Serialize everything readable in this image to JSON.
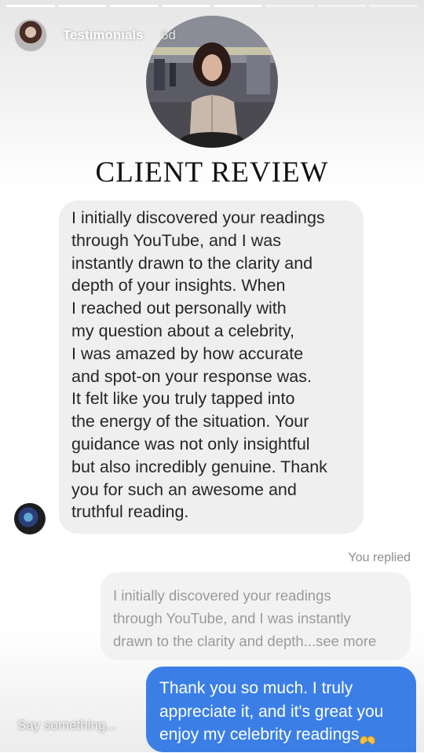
{
  "story": {
    "username": "Testimonials",
    "time_ago": "6d",
    "segments_total": 8,
    "segments_viewed": 5
  },
  "title": "CLIENT REVIEW",
  "messages": {
    "incoming_lines": [
      "I initially discovered your readings",
      "through YouTube, and I was",
      "instantly drawn to the clarity and",
      "depth of your insights. When",
      "I reached out personally with",
      "my question about a celebrity,",
      "I was amazed by how accurate",
      "and spot-on your response was.",
      "It felt like you truly tapped into",
      "the energy of the situation. Your",
      "guidance was not only insightful",
      "but also incredibly genuine. Thank",
      "you for such an awesome and",
      "truthful reading."
    ],
    "replied_label": "You replied",
    "quoted_lines": [
      "I initially discovered your readings",
      "through YouTube, and I was instantly",
      "drawn to the clarity and depth...see more"
    ],
    "reply_lines": [
      "Thank you so much. I truly",
      "appreciate it, and it's great you",
      "enjoy my celebrity readings"
    ],
    "reply_emoji": "heart-hands-icon"
  },
  "composer": {
    "placeholder": "Say something..."
  },
  "colors": {
    "accent_blue": "#3b7fe6",
    "bubble_gray": "#efefef",
    "muted_text": "#8e8e8e"
  }
}
